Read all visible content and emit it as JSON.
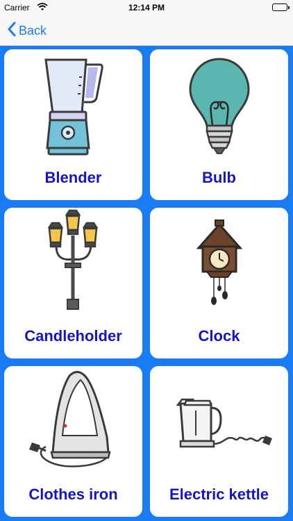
{
  "status_bar": {
    "carrier": "Carrier",
    "time": "12:14 PM"
  },
  "nav": {
    "back_label": "Back"
  },
  "items": [
    {
      "label": "Blender",
      "icon": "blender-icon"
    },
    {
      "label": "Bulb",
      "icon": "bulb-icon"
    },
    {
      "label": "Candleholder",
      "icon": "candleholder-icon"
    },
    {
      "label": "Clock",
      "icon": "clock-icon"
    },
    {
      "label": "Clothes iron",
      "icon": "clothes-iron-icon"
    },
    {
      "label": "Electric kettle",
      "icon": "electric-kettle-icon"
    }
  ],
  "colors": {
    "accent": "#1a7cf5",
    "label": "#1414c8",
    "card": "#ffffff"
  }
}
